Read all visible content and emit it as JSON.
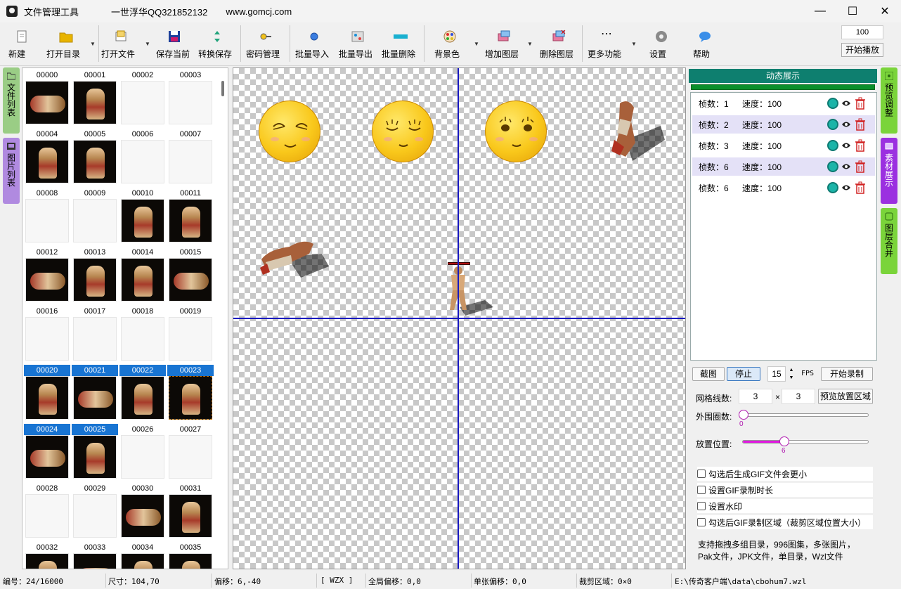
{
  "window": {
    "title": "文件管理工具",
    "author": "一世浮华QQ321852132",
    "website": "www.gomcj.com",
    "minimize_label": "—",
    "maximize_label": "☐",
    "close_label": "✕"
  },
  "toolbar": {
    "new": "新建",
    "open_dir": "打开目录",
    "open_file": "打开文件",
    "save_current": "保存当前",
    "convert_save": "转换保存",
    "password": "密码管理",
    "batch_import": "批量导入",
    "batch_export": "批量导出",
    "batch_delete": "批量删除",
    "bg_color": "背景色",
    "add_layer": "增加图层",
    "delete_layer": "删除图层",
    "more": "更多功能",
    "settings": "设置",
    "help": "帮助",
    "speed_value": "100",
    "start_play": "开始播放"
  },
  "left_tabs": {
    "file_list": "文件列表",
    "image_list": "图片列表"
  },
  "thumbnails": {
    "rows": [
      [
        "00000",
        "00001",
        "00002",
        "00003"
      ],
      [
        "00004",
        "00005",
        "00006",
        "00007"
      ],
      [
        "00008",
        "00009",
        "00010",
        "00011"
      ],
      [
        "00012",
        "00013",
        "00014",
        "00015"
      ],
      [
        "00016",
        "00017",
        "00018",
        "00019"
      ],
      [
        "00020",
        "00021",
        "00022",
        "00023"
      ],
      [
        "00024",
        "00025",
        "00026",
        "00027"
      ],
      [
        "00028",
        "00029",
        "00030",
        "00031"
      ],
      [
        "00032",
        "00033",
        "00034",
        "00035"
      ]
    ],
    "selected": [
      "00020",
      "00021",
      "00022",
      "00023",
      "00024",
      "00025"
    ]
  },
  "right_panel": {
    "header": "动态展示",
    "frames": [
      {
        "frames_label": "桢数：1",
        "speed_label": "速度：100"
      },
      {
        "frames_label": "桢数：2",
        "speed_label": "速度：100"
      },
      {
        "frames_label": "桢数：3",
        "speed_label": "速度：100"
      },
      {
        "frames_label": "桢数：6",
        "speed_label": "速度：100"
      },
      {
        "frames_label": "桢数：6",
        "speed_label": "速度：100"
      }
    ],
    "screenshot": "截图",
    "stop": "停止",
    "fps_value": "15",
    "fps_unit": "FPS",
    "start_record": "开始录制",
    "grid_label": "网格线数:",
    "grid_x": "3",
    "grid_times": "×",
    "grid_y": "3",
    "preview_area": "预览放置区域",
    "outer_label": "外围圈数:",
    "outer_value": "0",
    "outer_fraction": 0,
    "position_label": "放置位置:",
    "position_value": "6",
    "position_fraction": 0.33,
    "checks": [
      "勾选后生成GIF文件会更小",
      "设置GIF录制时长",
      "设置水印",
      "勾选后GIF录制区域（裁剪区域位置大小）"
    ],
    "info_line1": "支持拖拽多组目录，996图集，多张图片，",
    "info_line2": "Pak文件，JPK文件，单目录，Wzl文件"
  },
  "right_tabs": {
    "preview": "预览调整",
    "material": "素材展示",
    "merge": "图层合并"
  },
  "status": {
    "index": "编号：24/16000",
    "size": "尺寸：104,70",
    "offset": "偏移：6,-40",
    "format": "[ WZX ]",
    "global_offset": "全局偏移：0,0",
    "single_offset": "单张偏移：0,0",
    "crop": "裁剪区域：0×0",
    "path": "E:\\传奇客户端\\data\\cbohum7.wzl"
  },
  "colors": {
    "accent_teal": "#0e7f6f",
    "selection_blue": "#1874d2",
    "guide_blue": "#1818c0",
    "tab_green": "#7ad43a",
    "tab_purple": "#9b30e0",
    "slider_magenta": "#e01ae0"
  }
}
